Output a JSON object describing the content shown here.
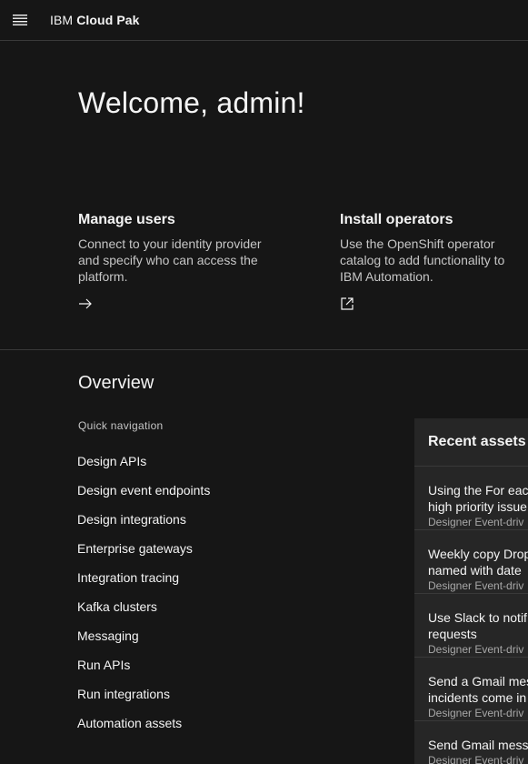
{
  "header": {
    "brand_prefix": "IBM",
    "brand_product": "Cloud Pak",
    "menu_icon": "hamburger-menu-icon"
  },
  "welcome": "Welcome, admin!",
  "cards": {
    "users": {
      "title": "Manage users",
      "description": "Connect to your identity provider and specify who can access the platform.",
      "icon": "arrow-right-icon"
    },
    "operators": {
      "title": "Install operators",
      "description": "Use the OpenShift operator catalog to add functionality to IBM Automation.",
      "icon": "launch-icon"
    }
  },
  "overview": {
    "title": "Overview",
    "quick_nav_label": "Quick navigation",
    "items": [
      "Design APIs",
      "Design event endpoints",
      "Design integrations",
      "Enterprise gateways",
      "Integration tracing",
      "Kafka clusters",
      "Messaging",
      "Run APIs",
      "Run integrations",
      "Automation assets"
    ]
  },
  "recent_assets": {
    "title": "Recent assets",
    "items": [
      {
        "line1": "Using the For eac",
        "line2": "high priority issue",
        "type": "Designer Event-driv"
      },
      {
        "line1": "Weekly copy Drop",
        "line2": "named with date",
        "type": "Designer Event-driv"
      },
      {
        "line1": "Use Slack to notif",
        "line2": "requests",
        "type": "Designer Event-driv"
      },
      {
        "line1": "Send a Gmail mes",
        "line2": "incidents come in",
        "type": "Designer Event-driv"
      },
      {
        "line1": "Send Gmail mess",
        "line2": "",
        "type": "Designer Event-driv"
      }
    ]
  },
  "colors": {
    "background": "#161616",
    "panel": "#262626",
    "divider": "#393939",
    "text_primary": "#f4f4f4",
    "text_secondary": "#c6c6c6"
  }
}
